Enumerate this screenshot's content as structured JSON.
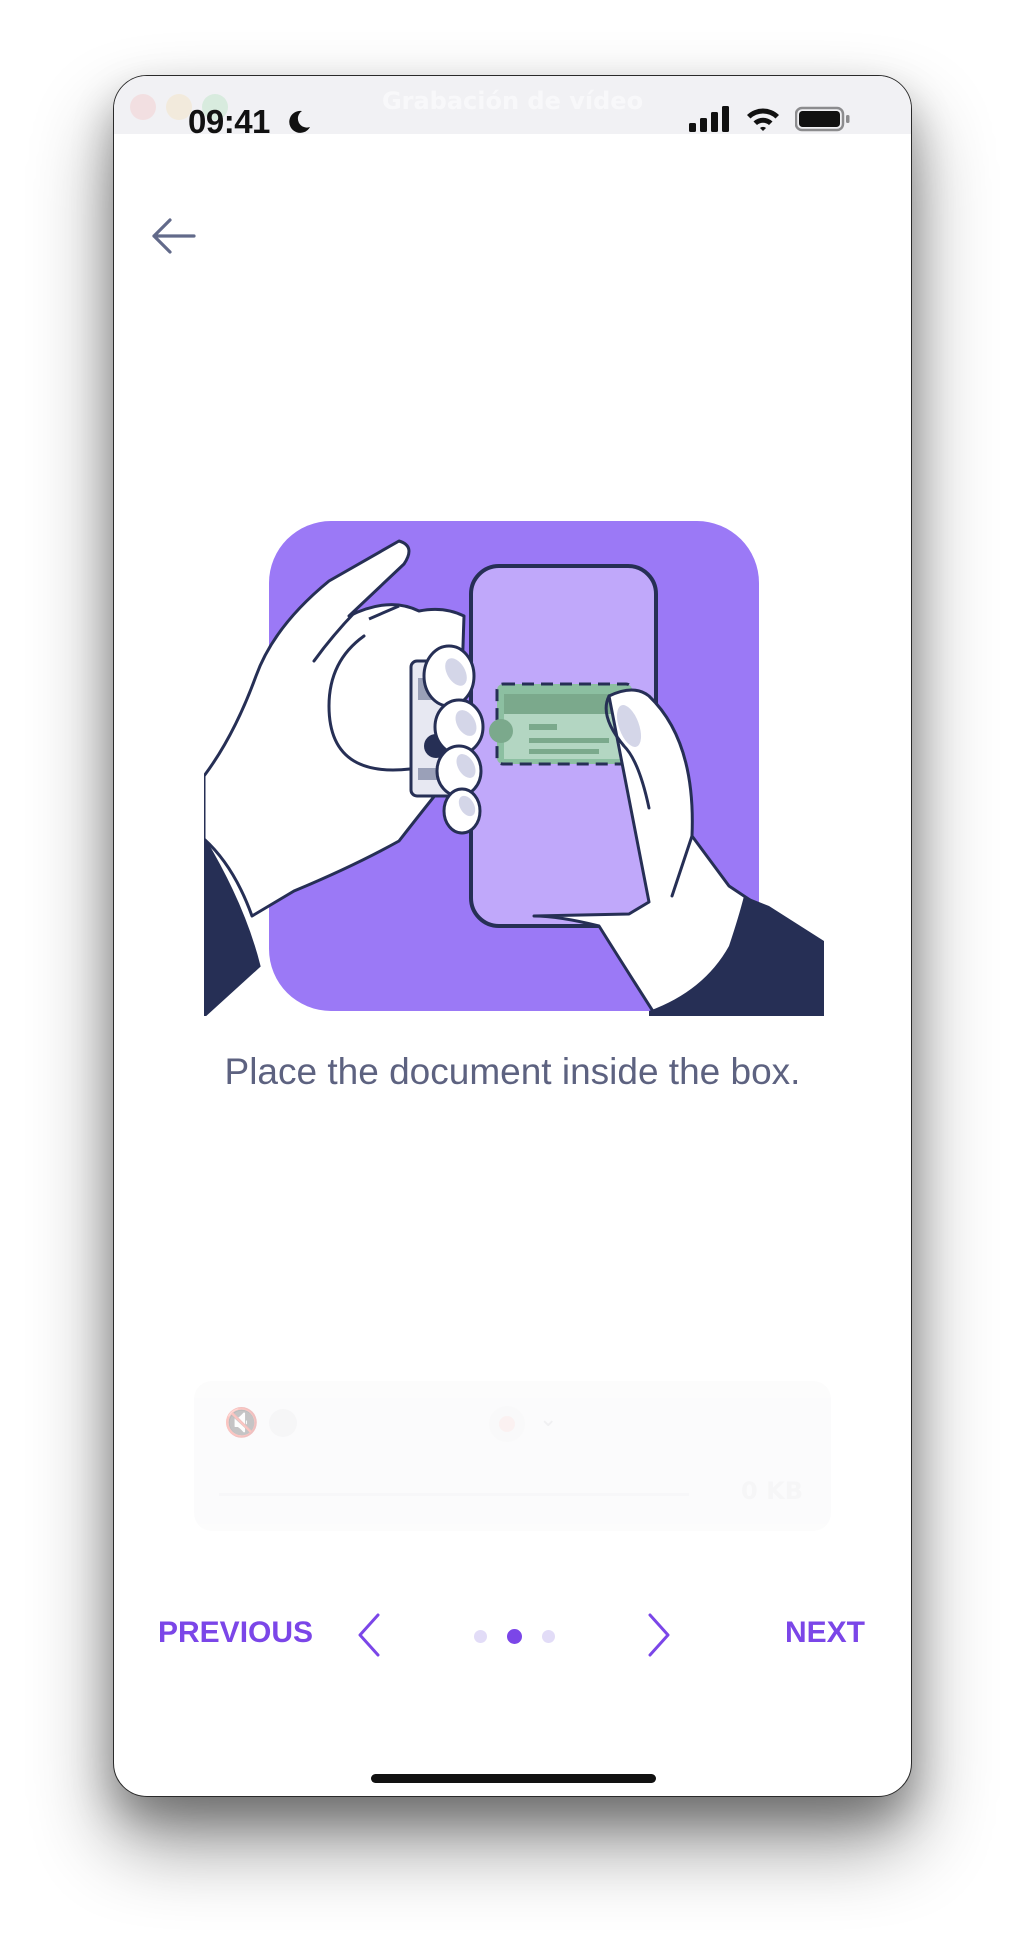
{
  "window": {
    "title": "Grabación de vídeo"
  },
  "status_bar": {
    "time": "09:41",
    "icons": [
      "moon-icon",
      "signal-icon",
      "wifi-icon",
      "battery-icon"
    ]
  },
  "header": {
    "back_icon": "arrow-left-icon"
  },
  "illustration": {
    "description_icon": "hands-phone-scanning-document"
  },
  "instruction": {
    "text": "Place the document inside the box."
  },
  "recorder": {
    "size_label": "0 KB"
  },
  "navigation": {
    "previous_label": "PREVIOUS",
    "next_label": "NEXT",
    "page_count": 3,
    "active_page": 2
  },
  "colors": {
    "accent": "#7b46e8",
    "hero_bg": "#9b79f6",
    "phone": "#c0a8fa",
    "navy": "#262f55",
    "card": "#a8cfb6"
  }
}
